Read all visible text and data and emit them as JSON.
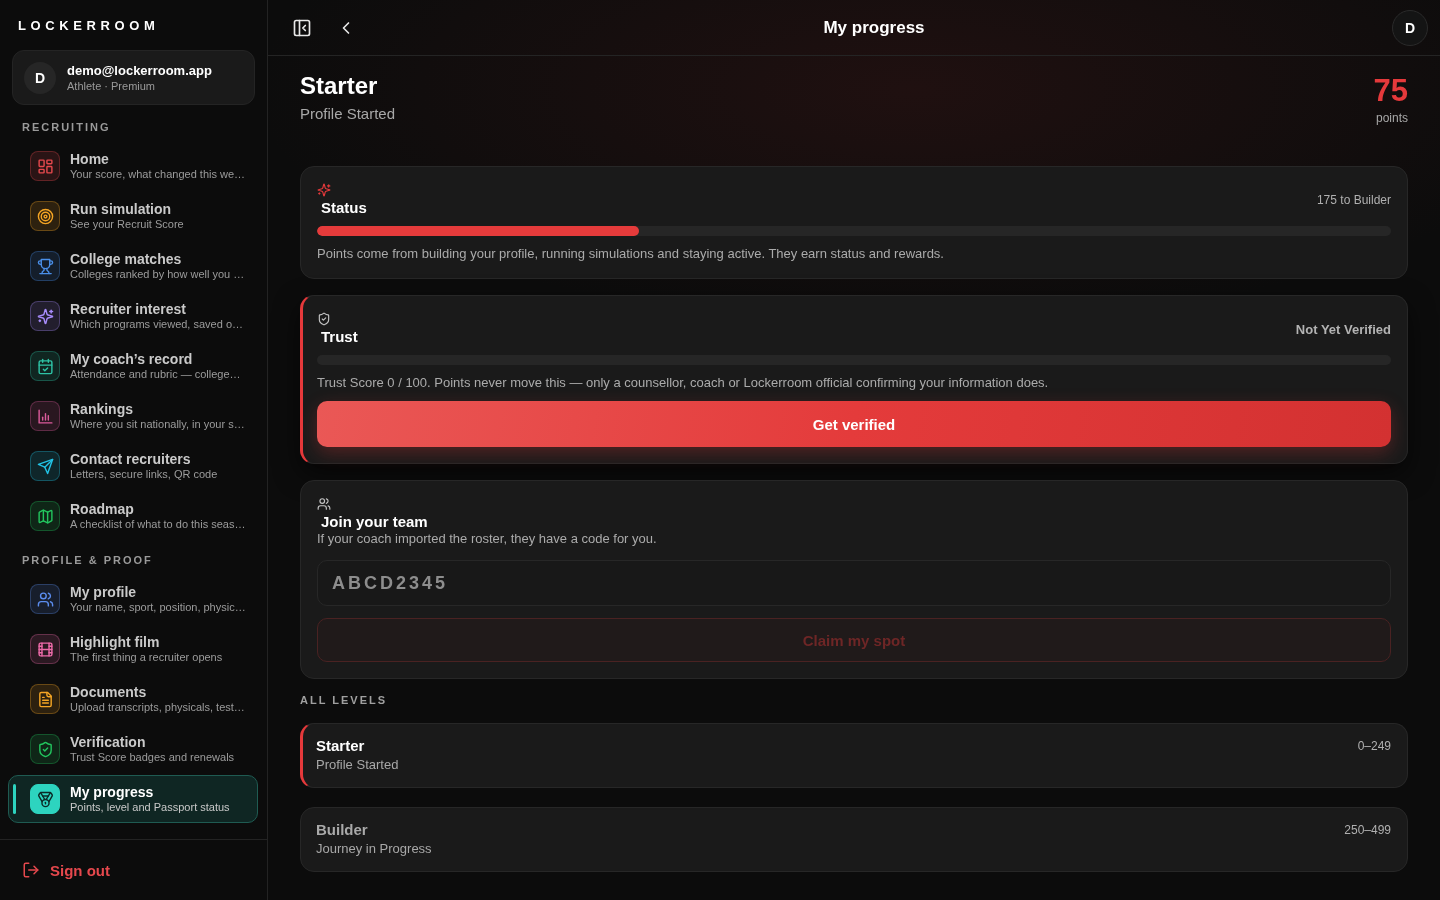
{
  "sidebar": {
    "logo": "LOCKERROOM",
    "account": {
      "avatar": "D",
      "email": "demo@lockerroom.app",
      "plan": "Athlete · Premium"
    },
    "sections": [
      {
        "title": "RECRUITING",
        "items": [
          {
            "title": "Home",
            "subtitle": "Your score, what changed this we…",
            "color": "#e5484d",
            "selected": false
          },
          {
            "title": "Run simulation",
            "subtitle": "See your Recruit Score",
            "color": "#f5a524",
            "selected": false
          },
          {
            "title": "College matches",
            "subtitle": "Colleges ranked by how well you …",
            "color": "#4a8fe8",
            "selected": false
          },
          {
            "title": "Recruiter interest",
            "subtitle": "Which programs viewed, saved o…",
            "color": "#a78bfa",
            "selected": false
          },
          {
            "title": "My coach’s record",
            "subtitle": "Attendance and rubric — college…",
            "color": "#2ec4a6",
            "selected": false
          },
          {
            "title": "Rankings",
            "subtitle": "Where you sit nationally, in your s…",
            "color": "#db5b9b",
            "selected": false
          },
          {
            "title": "Contact recruiters",
            "subtitle": "Letters, secure links, QR code",
            "color": "#22c3e6",
            "selected": false
          },
          {
            "title": "Roadmap",
            "subtitle": "A checklist of what to do this seas…",
            "color": "#22c55e",
            "selected": false
          }
        ]
      },
      {
        "title": "PROFILE & PROOF",
        "items": [
          {
            "title": "My profile",
            "subtitle": "Your name, sport, position, physic…",
            "color": "#5b8def",
            "selected": false
          },
          {
            "title": "Highlight film",
            "subtitle": "The first thing a recruiter opens",
            "color": "#ec6aa8",
            "selected": false
          },
          {
            "title": "Documents",
            "subtitle": "Upload transcripts, physicals, test…",
            "color": "#f5a524",
            "selected": false
          },
          {
            "title": "Verification",
            "subtitle": "Trust Score badges and renewals",
            "color": "#22c55e",
            "selected": false
          },
          {
            "title": "My progress",
            "subtitle": "Points, level and Passport status",
            "color": "#2dd4bf",
            "selected": true
          }
        ]
      }
    ],
    "sign_out": "Sign out"
  },
  "header": {
    "title": "My progress",
    "avatar": "D"
  },
  "level": {
    "name": "Starter",
    "tagline": "Profile Started",
    "points": "75",
    "points_label": "points"
  },
  "status_card": {
    "title": "Status",
    "next": "175 to Builder",
    "level": 0.3,
    "note": "Points come from building your profile, running simulations and staying active. They earn status and rewards."
  },
  "trust_card": {
    "title": "Trust",
    "badge": "Not Yet Verified",
    "note": "Trust Score 0 / 100. Points never move this — only a counsellor, coach or Lockerroom official confirming your information does.",
    "button": "Get verified"
  },
  "team_card": {
    "title": "Join your team",
    "note": "If your coach imported the roster, they have a code for you.",
    "code_field": {
      "placeholder": "ABCD2345"
    },
    "button": {
      "label": "Claim my spot",
      "disabled": true
    }
  },
  "levels": {
    "heading": "ALL LEVELS",
    "items": [
      {
        "name": "Starter",
        "tagline": "Profile Started",
        "range": "0–249",
        "current": true
      },
      {
        "name": "Builder",
        "tagline": "Journey in Progress",
        "range": "250–499",
        "current": false
      }
    ]
  }
}
